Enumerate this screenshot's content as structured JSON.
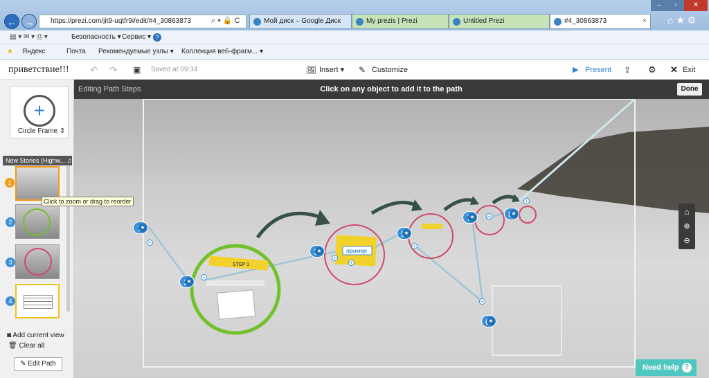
{
  "browser": {
    "address": "https://prezi.com/jit9-uqtfr9i/edit/#4_30863873",
    "tabs": [
      {
        "label": "Мой диск – Google Диск"
      },
      {
        "label": "My prezis | Prezi"
      },
      {
        "label": "Untitled Prezi"
      },
      {
        "label": "#4_30863873"
      }
    ],
    "tab_close": "×",
    "command_bar": {
      "safety": "Безопасность ▾",
      "service": "Сервис ▾",
      "help": "?"
    },
    "favorites": [
      {
        "label": "Яндекс"
      },
      {
        "label": "Почта"
      },
      {
        "label": "Рекомендуемые узлы ▾"
      },
      {
        "label": "Коллекция веб-фрагм... ▾"
      }
    ]
  },
  "toolbar": {
    "title": "приветствие!!!",
    "saved": "Saved at 09:34",
    "insert": "Insert ▾",
    "customize": "Customize",
    "present": "Present",
    "exit": "Exit"
  },
  "editbar": {
    "left": "Editing Path Steps",
    "center": "Click on any object to add it to the path",
    "done": "Done"
  },
  "leftpanel": {
    "frame_label": "Circle Frame ⇕",
    "audio_label": "New Stories (Highw...",
    "tooltip": "Click to zoom or drag to reorder",
    "thumb_numbers": [
      "1",
      "2",
      "3",
      "4"
    ],
    "add_current_view": "Add current view",
    "clear_all": "Clear all",
    "edit_path": "Edit Path"
  },
  "canvas": {
    "steps": [
      "1",
      "2",
      "3",
      "4",
      "5",
      "6",
      "7",
      "8"
    ],
    "step1_label": "STEP 1",
    "primer_label": "пример",
    "need_help": "Need help"
  },
  "colors": {
    "accent": "#3d8fd6",
    "green": "#72c02c",
    "pink": "#d0496b",
    "teal": "#3b4f4a",
    "help": "#4dc7c0"
  }
}
